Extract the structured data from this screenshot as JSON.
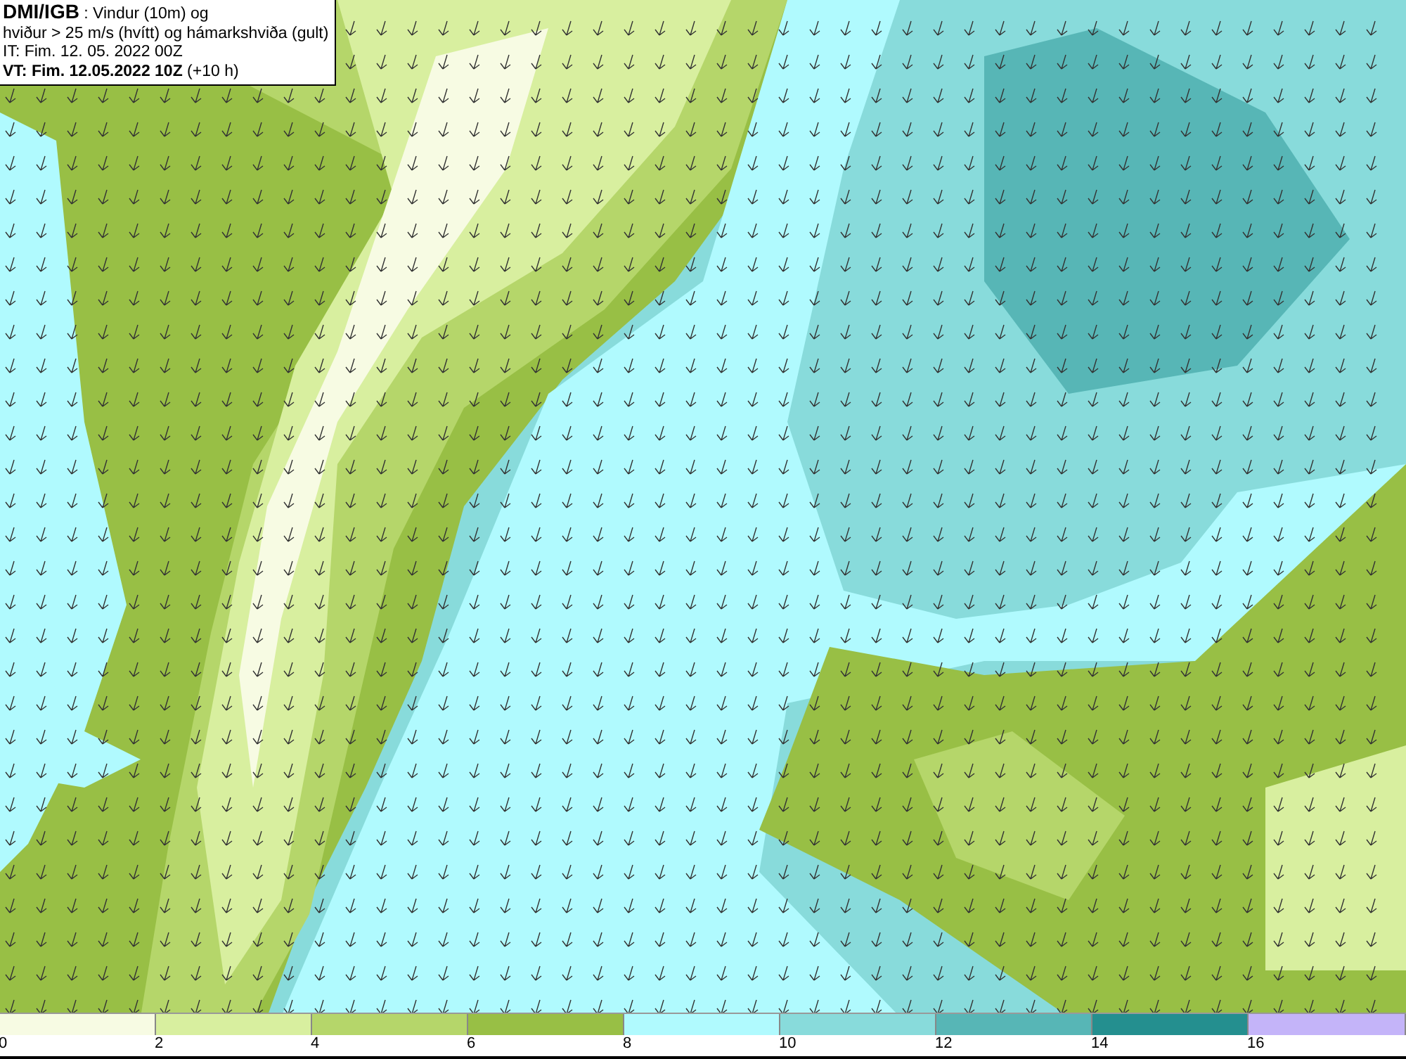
{
  "info_box": {
    "lines": [
      "**DMI/IGB** : Vindur (10m) og",
      "hviður > 25 m/s (hvítt) og hámarkshviða (gult)",
      "IT: Fim. 12. 05. 2022 00Z",
      "**VT: Fim. 12.05.2022 10Z** (+10 h)"
    ]
  },
  "legend": {
    "bins": [
      {
        "label": "0",
        "color": "#f7fbe3"
      },
      {
        "label": "2",
        "color": "#d8ef9f"
      },
      {
        "label": "4",
        "color": "#b5d66a"
      },
      {
        "label": "6",
        "color": "#98bf45"
      },
      {
        "label": "8",
        "color": "#b0fafe"
      },
      {
        "label": "10",
        "color": "#88dbdb"
      },
      {
        "label": "12",
        "color": "#57b6b6"
      },
      {
        "label": "14",
        "color": "#248f8f"
      },
      {
        "label": "16",
        "color": "#c4b4f9"
      }
    ]
  }
}
